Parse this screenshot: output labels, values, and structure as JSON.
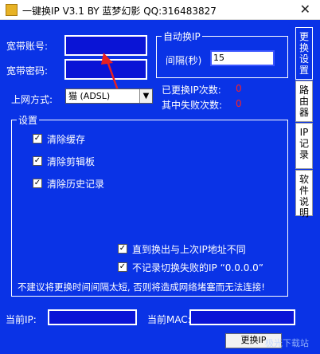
{
  "window": {
    "title": "一键换IP V3.1 BY 蓝梦幻影 QQ:316483827",
    "close_glyph": "✕"
  },
  "account": {
    "username_label": "宽带账号:",
    "password_label": "宽带密码:",
    "username_value": "",
    "password_value": ""
  },
  "auto_switch": {
    "legend": "自动换IP",
    "interval_label": "间隔(秒)",
    "interval_value": "15"
  },
  "network": {
    "label": "上网方式:",
    "selected": "猫 (ADSL)"
  },
  "stats": {
    "changed_label": "已更换IP次数:",
    "changed_value": "0",
    "failed_label": "其中失败次数:",
    "failed_value": "0"
  },
  "settings": {
    "legend": "设置",
    "options": [
      {
        "label": "清除缓存",
        "checked": true
      },
      {
        "label": "清除剪辑板",
        "checked": true
      },
      {
        "label": "清除历史记录",
        "checked": true
      },
      {
        "label": "直到换出与上次IP地址不同",
        "checked": true
      },
      {
        "label": "不记录切换失败的IP “0.0.0.0”",
        "checked": true
      }
    ],
    "warning": "不建议将更换时间间隔太短, 否则将造成网络堵塞而无法连接!"
  },
  "status": {
    "ip_label": "当前IP:",
    "ip_value": "",
    "mac_label": "当前MAC:",
    "mac_value": ""
  },
  "tabs": [
    "更换设置",
    "路由器",
    "IP记录",
    "软件说明"
  ],
  "change_button": "更换IP",
  "watermark": "极光下载站",
  "colors": {
    "background": "#0a33e6",
    "input": "#0a14d6",
    "counter": "#ff2020"
  }
}
